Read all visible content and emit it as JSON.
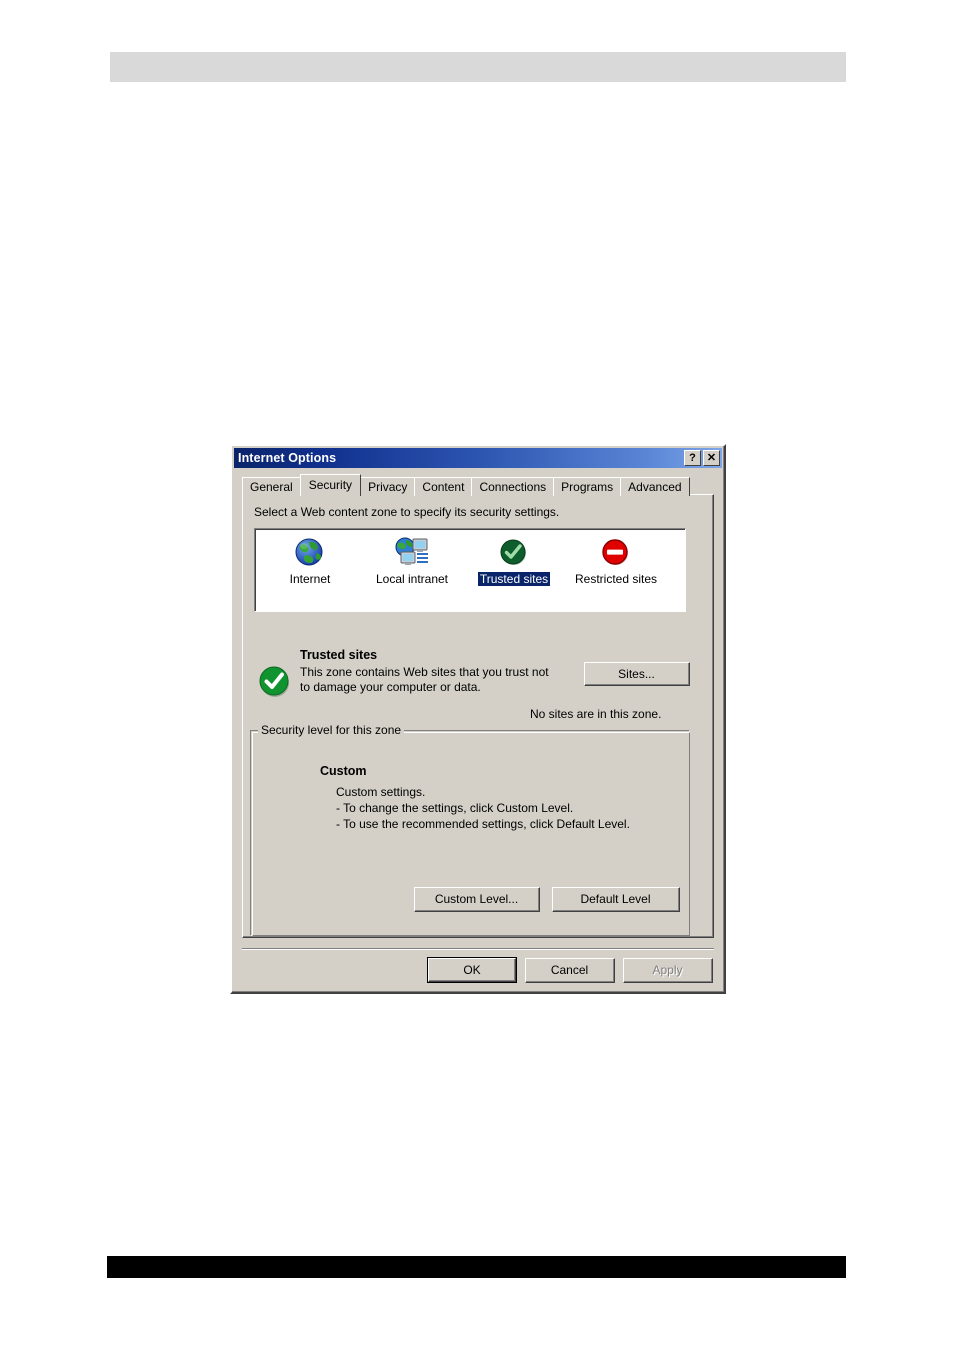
{
  "page": {
    "header_band_color": "#d9d9d9",
    "footer_band_color": "#000000"
  },
  "dialog": {
    "title": "Internet Options",
    "help_button_label": "?",
    "close_button_label": "✕",
    "background_color": "#d4d0c8",
    "titlebar_gradient_start": "#0a246a",
    "titlebar_gradient_end": "#7ea6e6"
  },
  "tabs": [
    {
      "label": "General",
      "selected": false
    },
    {
      "label": "Security",
      "selected": true
    },
    {
      "label": "Privacy",
      "selected": false
    },
    {
      "label": "Content",
      "selected": false
    },
    {
      "label": "Connections",
      "selected": false
    },
    {
      "label": "Programs",
      "selected": false
    },
    {
      "label": "Advanced",
      "selected": false
    }
  ],
  "security_tab": {
    "instruction": "Select a Web content zone to specify its security settings.",
    "zones": [
      {
        "label": "Internet",
        "icon": "globe-icon",
        "selected": false
      },
      {
        "label": "Local intranet",
        "icon": "intranet-icon",
        "selected": false
      },
      {
        "label": "Trusted sites",
        "icon": "green-check-icon",
        "selected": true
      },
      {
        "label": "Restricted sites",
        "icon": "red-prohibition-icon",
        "selected": false
      }
    ],
    "selected_zone": {
      "name": "Trusted sites",
      "description": "This zone contains Web sites that you trust not to damage your computer or data.",
      "icon": "green-check-icon",
      "sites_button": "Sites...",
      "sites_status": "No sites are in this zone."
    },
    "security_level": {
      "legend": "Security level for this zone",
      "level_name": "Custom",
      "lines": [
        "Custom settings.",
        "- To change the settings, click Custom Level.",
        "- To use the recommended settings, click Default Level."
      ],
      "custom_level_button": "Custom Level...",
      "default_level_button": "Default Level"
    }
  },
  "footer_buttons": {
    "ok": "OK",
    "cancel": "Cancel",
    "apply": "Apply"
  },
  "colors": {
    "selection_blue": "#0a246a",
    "face": "#d4d0c8",
    "trusted_green": "#108a28",
    "restricted_red": "#e00000"
  }
}
